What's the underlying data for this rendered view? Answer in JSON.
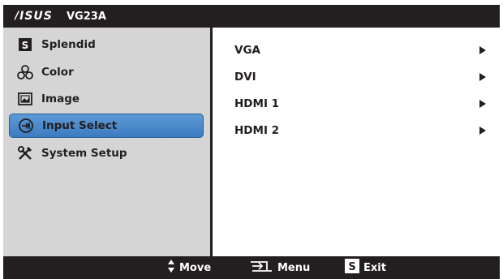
{
  "header": {
    "brand": "/ISUS",
    "model": "VG23A"
  },
  "sidebar": {
    "items": [
      {
        "label": "Splendid",
        "icon": "splendid-s-icon"
      },
      {
        "label": "Color",
        "icon": "color-circles-icon"
      },
      {
        "label": "Image",
        "icon": "image-icon"
      },
      {
        "label": "Input Select",
        "icon": "input-select-icon",
        "selected": true
      },
      {
        "label": "System Setup",
        "icon": "wrench-screwdriver-icon"
      }
    ]
  },
  "main": {
    "rows": [
      {
        "label": "VGA"
      },
      {
        "label": "DVI"
      },
      {
        "label": "HDMI 1"
      },
      {
        "label": "HDMI 2"
      }
    ]
  },
  "footer": {
    "move_label": "Move",
    "menu_label": "Menu",
    "exit_label": "Exit"
  },
  "colors": {
    "bar": "#231f20",
    "sidebar_bg": "#d5d5d5",
    "selected": "#4a88cb"
  }
}
